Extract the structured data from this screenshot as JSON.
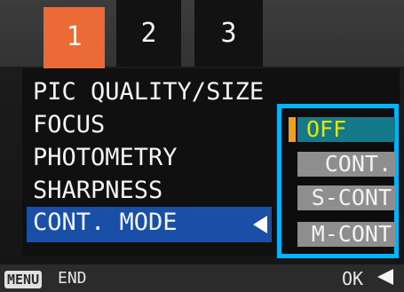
{
  "tabs": [
    {
      "label": "1",
      "active": true
    },
    {
      "label": "2",
      "active": false
    },
    {
      "label": "3",
      "active": false
    }
  ],
  "menu": {
    "items": [
      "PIC QUALITY/SIZE",
      "FOCUS",
      "PHOTOMETRY",
      "SHARPNESS",
      "CONT. MODE"
    ],
    "selected_index": 4
  },
  "options": {
    "items": [
      "OFF",
      "CONT.",
      "S-CONT",
      "M-CONT"
    ],
    "selected_index": 0
  },
  "footer": {
    "menu_key": "MENU",
    "end_label": "END",
    "ok_label": "OK"
  },
  "colors": {
    "active_tab": "#ec6a36",
    "highlight": "#1a4fa8",
    "options_frame": "#00b4ff",
    "selected_option_bg": "#147a8a",
    "selected_option_text": "#e6e600"
  }
}
